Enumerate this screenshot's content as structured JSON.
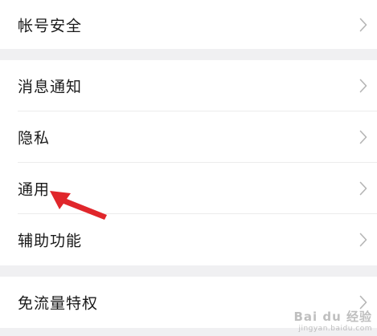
{
  "settings": {
    "groups": [
      {
        "items": [
          {
            "label": "帐号安全"
          }
        ]
      },
      {
        "items": [
          {
            "label": "消息通知"
          },
          {
            "label": "隐私"
          },
          {
            "label": "通用"
          },
          {
            "label": "辅助功能"
          }
        ]
      },
      {
        "items": [
          {
            "label": "免流量特权"
          }
        ]
      }
    ]
  },
  "watermark": {
    "main": "Bai du 经验",
    "sub": "jingyan.baidu.com"
  },
  "colors": {
    "background": "#f0f0f2",
    "row": "#ffffff",
    "text": "#1a1a1a",
    "chevron": "#b5b5b5",
    "annotation_arrow": "#e0262b"
  },
  "icons": {
    "row_chevron": "chevron-right-icon",
    "annotation": "red-arrow-annotation"
  }
}
